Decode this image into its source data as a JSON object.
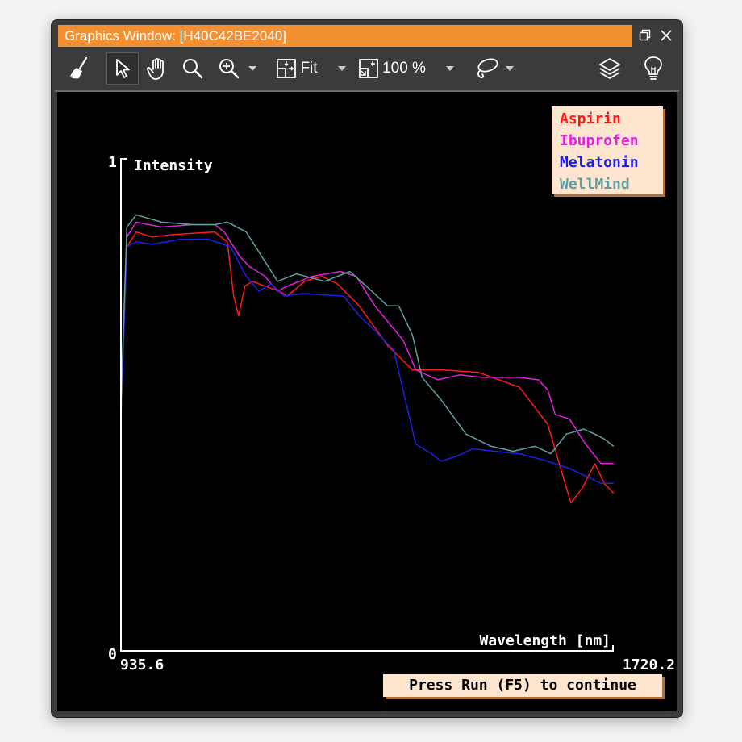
{
  "window": {
    "title": "Graphics Window: [H40C42BE2040]",
    "title_bg": "#f39132"
  },
  "toolbar": {
    "icons": [
      "broom-icon",
      "select-arrow-icon",
      "pan-hand-icon",
      "zoom-icon",
      "zoom-in-icon",
      "fit-icon",
      "zoom-percent-icon",
      "lasso-icon",
      "layers-icon",
      "lightbulb-icon"
    ],
    "fit_label": "Fit",
    "zoom_label": "100 %"
  },
  "chart_data": {
    "type": "line",
    "ylabel": "Intensity",
    "xlabel": "Wavelength [nm]",
    "xlim": [
      935.6,
      1720.2
    ],
    "ylim": [
      0,
      1
    ],
    "x_tick_labels": [
      "935.6",
      "1720.2"
    ],
    "y_tick_labels": [
      "0",
      "1"
    ],
    "legend_position": "top-right",
    "series": [
      {
        "name": "Aspirin",
        "color": "#ff1a1a",
        "points": [
          [
            935.6,
            0.48
          ],
          [
            945,
            0.82
          ],
          [
            960,
            0.85
          ],
          [
            985,
            0.84
          ],
          [
            1020,
            0.845
          ],
          [
            1085,
            0.85
          ],
          [
            1105,
            0.83
          ],
          [
            1115,
            0.72
          ],
          [
            1123,
            0.68
          ],
          [
            1133,
            0.74
          ],
          [
            1145,
            0.75
          ],
          [
            1165,
            0.74
          ],
          [
            1188,
            0.73
          ],
          [
            1200,
            0.72
          ],
          [
            1228,
            0.75
          ],
          [
            1255,
            0.76
          ],
          [
            1280,
            0.745
          ],
          [
            1315,
            0.7
          ],
          [
            1360,
            0.62
          ],
          [
            1400,
            0.57
          ],
          [
            1450,
            0.57
          ],
          [
            1505,
            0.565
          ],
          [
            1570,
            0.535
          ],
          [
            1615,
            0.46
          ],
          [
            1638,
            0.36
          ],
          [
            1652,
            0.3
          ],
          [
            1670,
            0.33
          ],
          [
            1690,
            0.38
          ],
          [
            1705,
            0.34
          ],
          [
            1720,
            0.32
          ]
        ]
      },
      {
        "name": "Ibuprofen",
        "color": "#e41ee4",
        "points": [
          [
            935.6,
            0.5
          ],
          [
            945,
            0.84
          ],
          [
            960,
            0.87
          ],
          [
            1000,
            0.86
          ],
          [
            1050,
            0.865
          ],
          [
            1085,
            0.865
          ],
          [
            1100,
            0.85
          ],
          [
            1125,
            0.8
          ],
          [
            1140,
            0.78
          ],
          [
            1165,
            0.76
          ],
          [
            1185,
            0.73
          ],
          [
            1200,
            0.74
          ],
          [
            1240,
            0.76
          ],
          [
            1285,
            0.77
          ],
          [
            1310,
            0.76
          ],
          [
            1340,
            0.7
          ],
          [
            1385,
            0.63
          ],
          [
            1405,
            0.57
          ],
          [
            1440,
            0.55
          ],
          [
            1475,
            0.56
          ],
          [
            1510,
            0.555
          ],
          [
            1570,
            0.555
          ],
          [
            1600,
            0.55
          ],
          [
            1615,
            0.53
          ],
          [
            1627,
            0.48
          ],
          [
            1650,
            0.47
          ],
          [
            1675,
            0.42
          ],
          [
            1700,
            0.38
          ],
          [
            1720,
            0.38
          ]
        ]
      },
      {
        "name": "Melatonin",
        "color": "#1f1fe6",
        "points": [
          [
            935.6,
            0.47
          ],
          [
            945,
            0.82
          ],
          [
            960,
            0.83
          ],
          [
            985,
            0.825
          ],
          [
            1030,
            0.835
          ],
          [
            1075,
            0.835
          ],
          [
            1110,
            0.82
          ],
          [
            1135,
            0.76
          ],
          [
            1155,
            0.73
          ],
          [
            1175,
            0.745
          ],
          [
            1195,
            0.72
          ],
          [
            1225,
            0.725
          ],
          [
            1290,
            0.72
          ],
          [
            1315,
            0.68
          ],
          [
            1340,
            0.65
          ],
          [
            1370,
            0.61
          ],
          [
            1390,
            0.5
          ],
          [
            1405,
            0.42
          ],
          [
            1430,
            0.4
          ],
          [
            1445,
            0.385
          ],
          [
            1470,
            0.395
          ],
          [
            1495,
            0.41
          ],
          [
            1530,
            0.405
          ],
          [
            1570,
            0.4
          ],
          [
            1615,
            0.385
          ],
          [
            1650,
            0.37
          ],
          [
            1700,
            0.34
          ],
          [
            1720,
            0.34
          ]
        ]
      },
      {
        "name": "WellMind",
        "color": "#5f9ea0",
        "points": [
          [
            935.6,
            0.5
          ],
          [
            945,
            0.86
          ],
          [
            960,
            0.885
          ],
          [
            1000,
            0.87
          ],
          [
            1050,
            0.865
          ],
          [
            1085,
            0.865
          ],
          [
            1105,
            0.87
          ],
          [
            1135,
            0.85
          ],
          [
            1160,
            0.8
          ],
          [
            1185,
            0.75
          ],
          [
            1215,
            0.765
          ],
          [
            1260,
            0.75
          ],
          [
            1300,
            0.77
          ],
          [
            1335,
            0.73
          ],
          [
            1360,
            0.7
          ],
          [
            1378,
            0.7
          ],
          [
            1400,
            0.64
          ],
          [
            1415,
            0.555
          ],
          [
            1445,
            0.51
          ],
          [
            1485,
            0.44
          ],
          [
            1525,
            0.415
          ],
          [
            1560,
            0.405
          ],
          [
            1595,
            0.415
          ],
          [
            1620,
            0.4
          ],
          [
            1645,
            0.44
          ],
          [
            1672,
            0.45
          ],
          [
            1690,
            0.44
          ],
          [
            1705,
            0.43
          ],
          [
            1720,
            0.415
          ]
        ]
      }
    ]
  },
  "status": {
    "press_run": "Press Run (F5) to continue"
  }
}
